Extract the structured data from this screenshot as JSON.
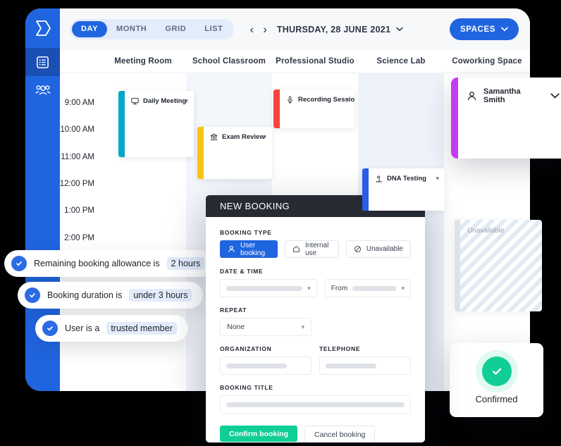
{
  "app": {
    "sidebar": {
      "logo_icon": "brand-logo-icon",
      "items": [
        {
          "name": "bookings",
          "icon": "list-icon",
          "active": true
        },
        {
          "name": "users",
          "icon": "people-icon",
          "active": false
        }
      ]
    },
    "topbar": {
      "views": [
        {
          "label": "DAY",
          "active": true
        },
        {
          "label": "MONTH",
          "active": false
        },
        {
          "label": "GRID",
          "active": false
        },
        {
          "label": "LIST",
          "active": false
        }
      ],
      "prev_icon": "chevron-left-icon",
      "next_icon": "chevron-right-icon",
      "date": "THURSDAY, 28 JUNE 2021",
      "date_caret": "chevron-down-icon",
      "spaces_label": "SPACES",
      "spaces_caret": "chevron-down-icon"
    },
    "columns": [
      "Meeting Room",
      "School Classroom",
      "Professional Studio",
      "Science Lab",
      "Coworking Space"
    ],
    "times": [
      "9:00 AM",
      "10:00 AM",
      "11:00 AM",
      "12:00 PM",
      "1:00 PM",
      "2:00 PM"
    ],
    "events": [
      {
        "title": "Daily Meeting",
        "icon": "presentation-icon",
        "color": "#04A7C9",
        "caret": "chevron-down-icon"
      },
      {
        "title": "Exam Review",
        "icon": "bank-icon",
        "color": "#FAC312",
        "caret": "chevron-down-icon"
      },
      {
        "title": "Recording Session",
        "icon": "microphone-icon",
        "color": "#F4443F",
        "caret": "chevron-down-icon"
      },
      {
        "title": "DNA Testing",
        "icon": "microscope-icon",
        "color": "#2B5BE8",
        "caret": "chevron-down-icon"
      }
    ],
    "unavailable_label": "Unavailable"
  },
  "user_card": {
    "name": "Samantha Smith",
    "avatar_icon": "person-icon",
    "caret": "chevron-down-icon",
    "accent": "#C53BF0"
  },
  "confirmed_card": {
    "label": "Confirmed",
    "icon": "check-circle-icon",
    "accent": "#10CE96"
  },
  "badges": [
    {
      "text": "Remaining booking allowance is",
      "highlight": "2 hours",
      "icon": "check-circle-icon"
    },
    {
      "text": "Booking duration is",
      "highlight": "under 3 hours",
      "icon": "check-circle-icon"
    },
    {
      "text": "User is a",
      "highlight": "trusted member",
      "icon": "check-circle-icon"
    }
  ],
  "modal": {
    "title": "NEW BOOKING",
    "booking_type_label": "BOOKING TYPE",
    "booking_types": [
      {
        "label": "User booking",
        "icon": "person-icon",
        "active": true
      },
      {
        "label": "Internal use",
        "icon": "home-icon",
        "active": false
      },
      {
        "label": "Unavailable",
        "icon": "block-icon",
        "active": false
      }
    ],
    "datetime_label": "DATE & TIME",
    "from_label": "From",
    "repeat_label": "REPEAT",
    "repeat_value": "None",
    "organization_label": "ORGANIZATION",
    "telephone_label": "TELEPHONE",
    "booking_title_label": "BOOKING TITLE",
    "confirm_label": "Confirm booking",
    "cancel_label": "Cancel booking",
    "accent_confirm": "#10CE96",
    "accent_primary": "#2065E0"
  }
}
